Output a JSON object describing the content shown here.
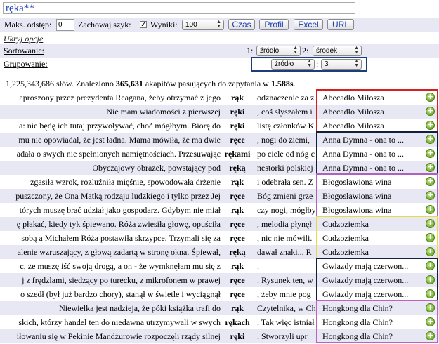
{
  "query": "ręka**",
  "controls": {
    "max_gap_label": "Maks. odstęp:",
    "max_gap_value": "0",
    "keep_order_label": "Zachowaj szyk:",
    "results_label": "Wyniki:",
    "results_value": "100",
    "btn_time": "Czas",
    "btn_profile": "Profil",
    "btn_excel": "Excel",
    "btn_url": "URL"
  },
  "options": {
    "hide_link": "Ukryj opcje",
    "sorting_label": "Sortowanie:",
    "sort_1_prefix": "1:",
    "sort_1_value": "źródło",
    "sort_2_prefix": "2:",
    "sort_2_value": "środek",
    "grouping_label": "Grupowanie:",
    "group_value": "źródło",
    "group_sep": ":",
    "group_count": "3"
  },
  "stats": {
    "words": "1,225,343,686 słów. Znaleziono ",
    "found": "365,631",
    "mid": " akapitów pasujących do zapytania w ",
    "time": "1.588s",
    "end": "."
  },
  "group_colors": [
    "#d81e1e",
    "#10203f",
    "#b060c0",
    "#e8d84a",
    "#10203f",
    "#c060c0"
  ],
  "rows": [
    {
      "left": "aproszony przez prezydenta Reagana, żeby otrzymać z jego",
      "kw": "rąk",
      "right": "odznaczenie za z",
      "src": "Abecadło Miłosza"
    },
    {
      "left": "Nie mam wiadomości z pierwszej",
      "kw": "ręki",
      "right": ", coś słyszałem i",
      "src": "Abecadło Miłosza"
    },
    {
      "left": "a: nie będę ich tutaj przywoływać, choć mógłbym. Biorę do",
      "kw": "ręki",
      "right": "listę członków K",
      "src": "Abecadło Miłosza"
    },
    {
      "left": "mu nie opowiadał, że jest ładna. Mama mówiła, że ma dwie",
      "kw": "ręce",
      "right": ", nogi do ziemi,",
      "src": "Anna Dymna - ona to ..."
    },
    {
      "left": "adała o swych nie spełnionych namiętnościach. Przesuwając",
      "kw": "rękami",
      "right": "po ciele od nóg c",
      "src": "Anna Dymna - ona to ..."
    },
    {
      "left": "Obyczajowy obrazek, powstający pod",
      "kw": "ręką",
      "right": "nestorki polskiej",
      "src": "Anna Dymna - ona to ..."
    },
    {
      "left": "zgasiła wzrok, rozluźniła mięśnie, spowodowała drżenie",
      "kw": "rąk",
      "right": "i odebrała sen. Z",
      "src": "Błogosławiona wina"
    },
    {
      "left": "puszczony, że Ona Matką rodzaju ludzkiego i tylko przez Jej",
      "kw": "ręce",
      "right": "Bóg zmieni grze",
      "src": "Błogosławiona wina"
    },
    {
      "left": "tórych muszę brać udział jako gospodarz. Gdybym nie miał",
      "kw": "rąk",
      "right": "czy nogi, mógłby",
      "src": "Błogosławiona wina"
    },
    {
      "left": "ę płakać, kiedy tyk śpiewano. Róża zwiesiła głowę, opuściła",
      "kw": "ręce",
      "right": ", melodia płynęł",
      "src": "Cudzoziemka"
    },
    {
      "left": "sobą a Michałem Róża postawiła skrzypce. Trzymali się za",
      "kw": "ręce",
      "right": ", nic nie mówili.",
      "src": "Cudzoziemka"
    },
    {
      "left": "alenie wzruszający, z głową zadartą w stronę okna. Śpiewał,",
      "kw": "ręką",
      "right": "dawał znaki... R",
      "src": "Cudzoziemka"
    },
    {
      "left": "c, że muszę iść swoją drogą, a on - że wymknęłam mu się z",
      "kw": "rąk",
      "right": ".",
      "src": "Gwiazdy mają czerwon..."
    },
    {
      "left": "j z frędzlami, siedzący po turecku, z mikrofonem w prawej",
      "kw": "ręce",
      "right": ". Rysunek ten, w",
      "src": "Gwiazdy mają czerwon..."
    },
    {
      "left": "o szedł (był już bardzo chory), stanął w świetle i wyciągnął",
      "kw": "ręce",
      "right": ", żeby mnie pog",
      "src": "Gwiazdy mają czerwon..."
    },
    {
      "left": "Niewielka jest nadzieja, że póki książka trafi do",
      "kw": "rąk",
      "right": "Czytelnika, w Ch",
      "src": "Hongkong dla Chin?"
    },
    {
      "left": "skich, którzy handel ten do niedawna utrzymywali w swych",
      "kw": "rękach",
      "right": ". Tak więc istniał",
      "src": "Hongkong dla Chin?"
    },
    {
      "left": "iłowaniu się w Pekinie Mandżurowie rozpoczęli rządy silnej",
      "kw": "ręki",
      "right": ". Stworzyli upr",
      "src": "Hongkong dla Chin?"
    }
  ]
}
